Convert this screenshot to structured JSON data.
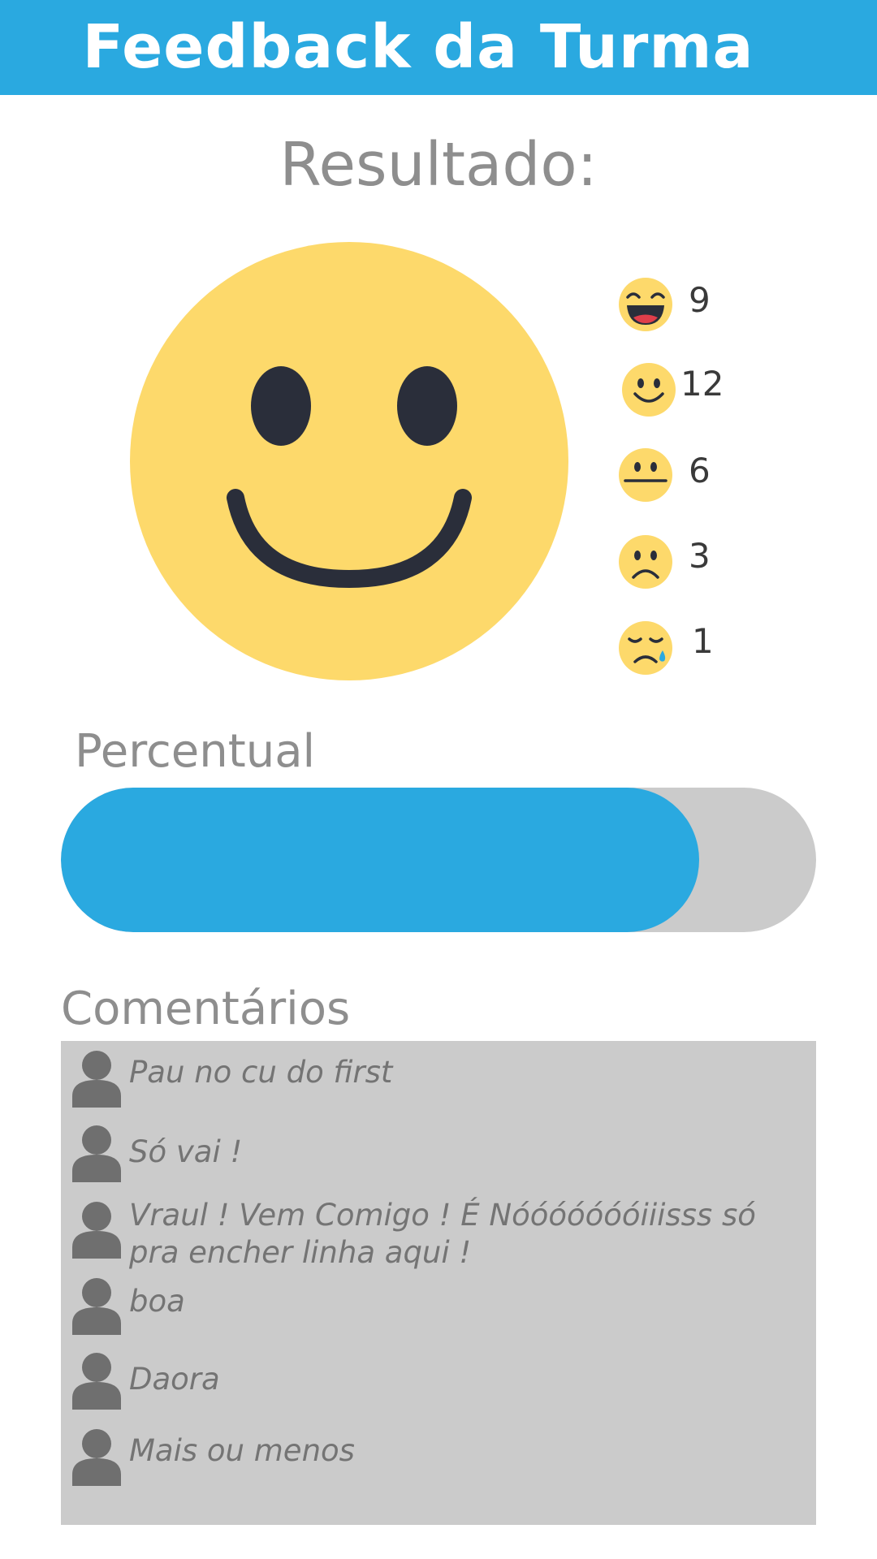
{
  "header": {
    "title": "Feedback da Turma",
    "background_color": "#2aa9e0"
  },
  "result": {
    "title": "Resultado:",
    "main_icon": "smiling-face-icon",
    "legend": [
      {
        "icon": "laughing-face-icon",
        "count": "9"
      },
      {
        "icon": "smiling-face-icon",
        "count": "12"
      },
      {
        "icon": "neutral-face-icon",
        "count": "6"
      },
      {
        "icon": "sad-face-icon",
        "count": "3"
      },
      {
        "icon": "crying-face-icon",
        "count": "1"
      }
    ]
  },
  "percentual": {
    "label": "Percentual",
    "fill_fraction": 0.845,
    "fill_color": "#2aa9e0",
    "track_color": "#cbcbcb"
  },
  "comments": {
    "label": "Comentários",
    "items": [
      {
        "text": "Pau no cu do first"
      },
      {
        "text": "Só vai !"
      },
      {
        "text": "Vraul ! Vem Comigo !  É Nóóóóóóóiiisss só pra encher linha aqui !"
      },
      {
        "text": "boa"
      },
      {
        "text": "Daora"
      },
      {
        "text": "Mais ou menos"
      }
    ]
  }
}
